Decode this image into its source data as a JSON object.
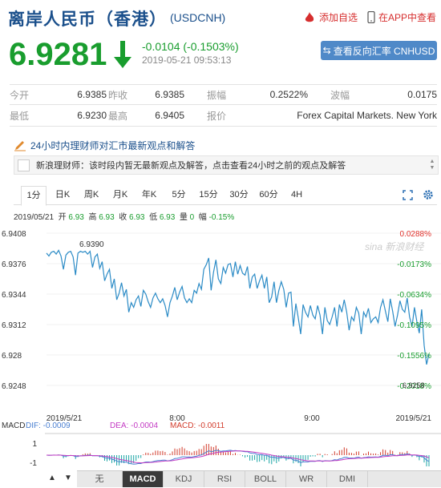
{
  "header": {
    "title": "离岸人民币（香港）",
    "code": "(USDCNH)",
    "add_watch": "添加自选",
    "app_watch": "在APP中查看"
  },
  "quote": {
    "price": "6.9281",
    "change": "-0.0104 (-0.1503%)",
    "time": "2019-05-21 09:53:13",
    "reverse_btn": "查看反向汇率 CNHUSD"
  },
  "stats": {
    "open_label": "今开",
    "open": "6.9385",
    "prev_label": "昨收",
    "prev": "6.9385",
    "amp_label": "振幅",
    "amp": "0.2522%",
    "wave_label": "波幅",
    "wave": "0.0175",
    "low_label": "最低",
    "low": "6.9230",
    "high_label": "最高",
    "high": "6.9405",
    "quote_label": "报价",
    "quote_src": "Forex Capital Markets. New York"
  },
  "news": {
    "heading": "24小时内理财师对汇市最新观点和解答",
    "text": "新浪理财师：该时段内暂无最新观点及解答，点击查看24小时之前的观点及解答"
  },
  "tabs": [
    "1分",
    "日K",
    "周K",
    "月K",
    "年K",
    "5分",
    "15分",
    "30分",
    "60分",
    "4H"
  ],
  "info": {
    "date": "2019/05/21",
    "o_l": "开",
    "o": "6.93",
    "h_l": "高",
    "h": "6.93",
    "c_l": "收",
    "c": "6.93",
    "lo_l": "低",
    "lo": "6.93",
    "v_l": "量",
    "v": "0",
    "f_l": "幅",
    "f": "-0.15%"
  },
  "macd": {
    "label": "MACD",
    "dif": "DIF: -0.0009",
    "dea": "DEA: -0.0004",
    "macd": "MACD: -0.0011"
  },
  "bottom_tabs": [
    "无",
    "MACD",
    "KDJ",
    "RSI",
    "BOLL",
    "WR",
    "DMI"
  ],
  "bottom_nav": [
    "▲",
    "▼"
  ],
  "colors": {
    "up": "#e0312b",
    "down": "#199d2e",
    "line": "#2b8bc6",
    "brand": "#1a4f8b"
  },
  "chart_data": {
    "type": "line",
    "y_ticks": [
      "6.9408",
      "6.9376",
      "6.9344",
      "6.9312",
      "6.928",
      "6.9248"
    ],
    "y_values": [
      6.9408,
      6.9376,
      6.9344,
      6.9312,
      6.928,
      6.9248
    ],
    "pct_ticks": [
      "0.0288%",
      "-0.0173%",
      "-0.0634%",
      "-0.1095%",
      "-0.1556%",
      "-0.2018%"
    ],
    "x_ticks": [
      "2019/5/21",
      "8:00",
      "9:00",
      "2019/5/21"
    ],
    "ylim": [
      6.9248,
      6.9408
    ],
    "annotations": {
      "max": "6.9390",
      "min": "6.9258"
    },
    "watermark": "sina 新浪财经",
    "series": [
      6.9387,
      6.9384,
      6.9388,
      6.9389,
      6.9386,
      6.939,
      6.9384,
      6.937,
      6.9385,
      6.9388,
      6.9389,
      6.9383,
      6.9364,
      6.9387,
      6.9389,
      6.9388,
      6.9389,
      6.9386,
      6.9389,
      6.9372,
      6.9383,
      6.9386,
      6.9371,
      6.9378,
      6.9358,
      6.9365,
      6.937,
      6.935,
      6.936,
      6.9338,
      6.9345,
      6.9356,
      6.9342,
      6.9349,
      6.9325,
      6.9335,
      6.933,
      6.9338,
      6.9342,
      6.9331,
      6.9348,
      6.9344,
      6.9336,
      6.933,
      6.934,
      6.9345,
      6.9339,
      6.9335,
      6.9339,
      6.9332,
      6.932,
      6.9335,
      6.9342,
      6.9351,
      6.9338,
      6.9346,
      6.9352,
      6.934,
      6.9335,
      6.9339,
      6.9335,
      6.9348,
      6.9345,
      6.9355,
      6.9349,
      6.937,
      6.9375,
      6.9382,
      6.9348,
      6.9367,
      6.938,
      6.936,
      6.9355,
      6.9372,
      6.9366,
      6.9375,
      6.9376,
      6.9362,
      6.9378,
      6.9365,
      6.9374,
      6.9366,
      6.9364,
      6.9373,
      6.935,
      6.9362,
      6.9365,
      6.935,
      6.9358,
      6.9364,
      6.935,
      6.9362,
      6.9335,
      6.9341,
      6.9357,
      6.9335,
      6.9348,
      6.9357,
      6.9349,
      6.933,
      6.9345,
      6.9346,
      6.931,
      6.9334,
      6.9319,
      6.9302,
      6.9333,
      6.9325,
      6.932,
      6.9332,
      6.9322,
      6.9318,
      6.9332,
      6.9322,
      6.9302,
      6.933,
      6.9316,
      6.9312,
      6.932,
      6.933,
      6.931,
      6.9333,
      6.9325,
      6.9338,
      6.9325,
      6.9306,
      6.932,
      6.9316,
      6.933,
      6.9324,
      6.9302,
      6.9325,
      6.932,
      6.9329,
      6.9314,
      6.9318,
      6.932,
      6.9314,
      6.933,
      6.9338,
      6.9326,
      6.9315,
      6.9339,
      6.9326,
      6.931,
      6.9322,
      6.9337,
      6.9328,
      6.9325,
      6.934,
      6.932,
      6.931,
      6.933,
      6.9315,
      6.9303,
      6.9328,
      6.929,
      6.927,
      6.9281
    ]
  }
}
